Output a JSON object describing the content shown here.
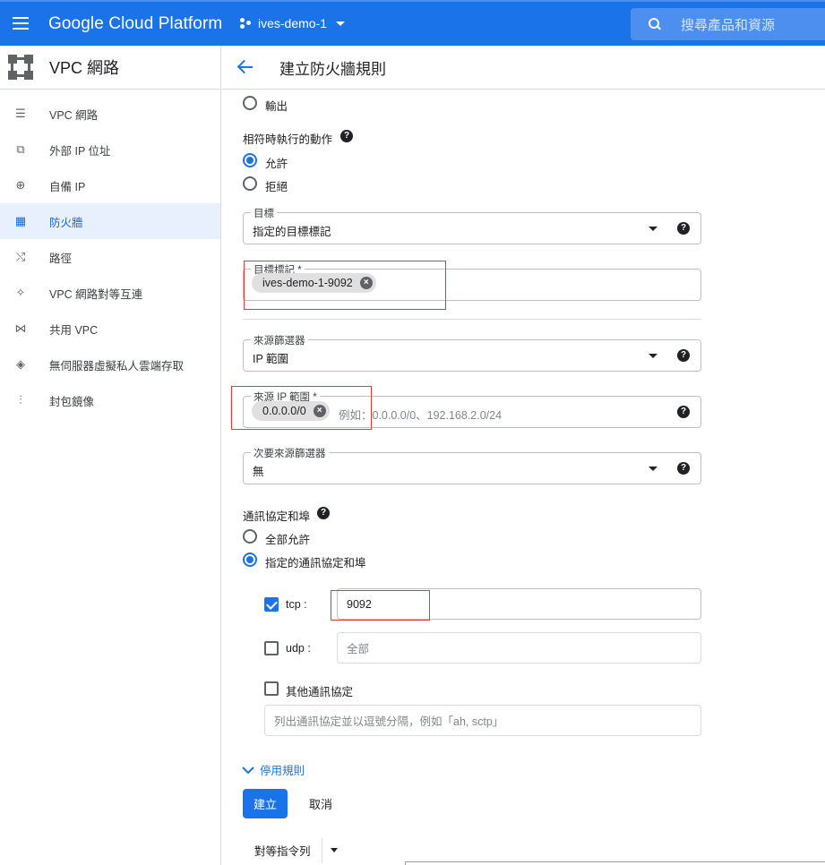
{
  "topbar": {
    "brand": "Google Cloud Platform",
    "project": "ives-demo-1",
    "search_placeholder": "搜尋產品和資源"
  },
  "sidebar": {
    "title": "VPC 網路",
    "items": [
      {
        "label": "VPC 網路",
        "icon": "server-icon",
        "active": false
      },
      {
        "label": "外部 IP 位址",
        "icon": "external-link-icon",
        "active": false
      },
      {
        "label": "自備 IP",
        "icon": "globe-icon",
        "active": false
      },
      {
        "label": "防火牆",
        "icon": "firewall-icon",
        "active": true
      },
      {
        "label": "路徑",
        "icon": "route-icon",
        "active": false
      },
      {
        "label": "VPC 網路對等互連",
        "icon": "peering-icon",
        "active": false
      },
      {
        "label": "共用 VPC",
        "icon": "shared-vpc-icon",
        "active": false
      },
      {
        "label": "無伺服器虛擬私人雲端存取",
        "icon": "serverless-icon",
        "active": false
      },
      {
        "label": "封包鏡像",
        "icon": "packet-mirroring-icon",
        "active": false
      }
    ]
  },
  "page": {
    "title": "建立防火牆規則"
  },
  "form": {
    "direction_egress": "輸出",
    "action_label": "相符時執行的動作",
    "action_allow": "允許",
    "action_deny": "拒絕",
    "target_label": "目標",
    "target_value": "指定的目標標記",
    "target_tags_label": "目標標記 *",
    "target_tag_chip": "ives-demo-1-9092",
    "source_filter_label": "來源篩選器",
    "source_filter_value": "IP 範圍",
    "source_ip_label": "來源 IP 範圍 *",
    "source_ip_chip": "0.0.0.0/0",
    "source_ip_placeholder": "例如：0.0.0.0/0、192.168.2.0/24",
    "second_filter_label": "次要來源篩選器",
    "second_filter_value": "無",
    "protocols_label": "通訊協定和埠",
    "allow_all": "全部允許",
    "specified_protocols": "指定的通訊協定和埠",
    "tcp_label": "tcp :",
    "tcp_value": "9092",
    "udp_label": "udp :",
    "udp_placeholder": "全部",
    "other_label": "其他通訊協定",
    "other_placeholder": "列出通訊協定並以逗號分隔，例如「ah, sctp」",
    "disable_rule": "停用規則",
    "create": "建立",
    "cancel": "取消",
    "equivalent": "對等指令列"
  },
  "colors": {
    "accent": "#1a73e8",
    "highlight_box": "#e53935"
  }
}
